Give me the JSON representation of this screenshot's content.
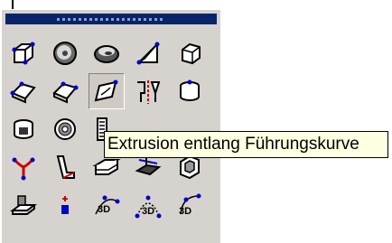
{
  "window": {
    "title": ""
  },
  "palette": {
    "tools": [
      {
        "row": 0,
        "col": 0,
        "icon": "box-solid-icon"
      },
      {
        "row": 0,
        "col": 1,
        "icon": "cylinder-disc-icon"
      },
      {
        "row": 0,
        "col": 2,
        "icon": "torus-icon"
      },
      {
        "row": 0,
        "col": 3,
        "icon": "wedge-icon"
      },
      {
        "row": 0,
        "col": 4,
        "icon": "cube-wireframe-icon"
      },
      {
        "row": 1,
        "col": 0,
        "icon": "extrude-icon"
      },
      {
        "row": 1,
        "col": 1,
        "icon": "extrude-both-icon"
      },
      {
        "row": 1,
        "col": 2,
        "icon": "extrude-along-path-icon",
        "pressed": true
      },
      {
        "row": 1,
        "col": 3,
        "icon": "mirror-solid-icon"
      },
      {
        "row": 1,
        "col": 4,
        "icon": "revolve-solid-icon"
      },
      {
        "row": 2,
        "col": 0,
        "icon": "shell-solid-icon"
      },
      {
        "row": 2,
        "col": 1,
        "icon": "washer-icon"
      },
      {
        "row": 2,
        "col": 2,
        "icon": "hatched-solid-icon"
      },
      {
        "row": 3,
        "col": 0,
        "icon": "y-branch-icon"
      },
      {
        "row": 3,
        "col": 1,
        "icon": "twisted-profile-icon"
      },
      {
        "row": 3,
        "col": 2,
        "icon": "stacked-plates-icon"
      },
      {
        "row": 3,
        "col": 3,
        "icon": "slice-solid-icon"
      },
      {
        "row": 3,
        "col": 4,
        "icon": "nested-box-icon"
      },
      {
        "row": 4,
        "col": 0,
        "icon": "surface-icon"
      },
      {
        "row": 4,
        "col": 1,
        "icon": "point-plus-icon"
      },
      {
        "row": 4,
        "col": 2,
        "icon": "3d-curve-icon"
      },
      {
        "row": 4,
        "col": 3,
        "icon": "3d-arc-icon"
      },
      {
        "row": 4,
        "col": 4,
        "icon": "3d-spline-icon"
      }
    ]
  },
  "tooltip": {
    "text": "Extrusion entlang Führungskurve"
  },
  "colors": {
    "accent": "#0a246a",
    "tooltip_bg": "#ffffe1",
    "icon_blue": "#0000cc",
    "icon_red": "#cc0000"
  }
}
